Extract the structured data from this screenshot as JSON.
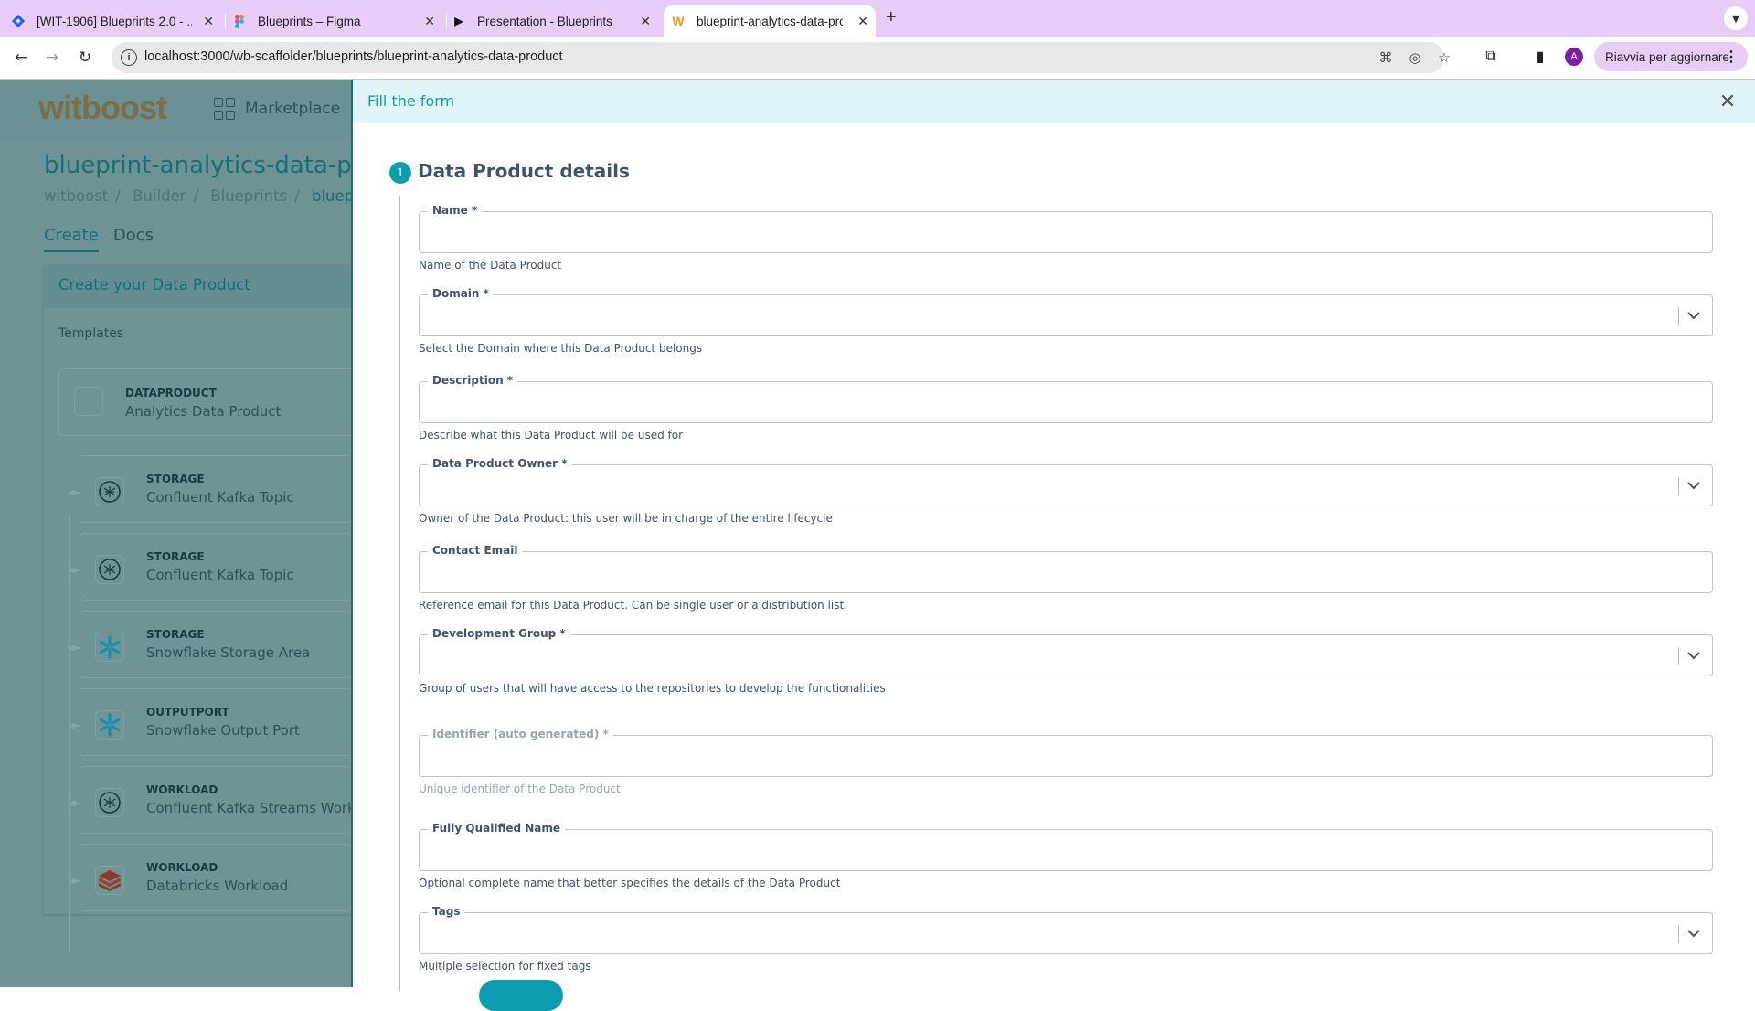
{
  "browser": {
    "tabs": [
      {
        "label": "[WIT-1906] Blueprints 2.0 - ...",
        "icon": "jira-icon",
        "active": false
      },
      {
        "label": "Blueprints – Figma",
        "icon": "figma-icon",
        "active": false
      },
      {
        "label": "Presentation - Blueprints",
        "icon": "play-icon",
        "active": false
      },
      {
        "label": "blueprint-analytics-data-pro",
        "icon": "witboost-icon",
        "active": true
      }
    ],
    "new_tab": "+",
    "url": "localhost:3000/wb-scaffolder/blueprints/blueprint-analytics-data-product",
    "profile_initial": "A",
    "update_button": "Riavvia per aggiornare",
    "colors": {
      "tabbar": "#e9cdf9",
      "profile": "#7b1fa2"
    }
  },
  "app": {
    "logo": "witboost",
    "nav": {
      "marketplace": "Marketplace"
    },
    "page_title": "blueprint-analytics-data-product",
    "breadcrumb": [
      "witboost",
      "Builder",
      "Blueprints",
      "blueprint-analytics-data-product"
    ],
    "tabs": [
      {
        "label": "Create",
        "active": true
      },
      {
        "label": "Docs",
        "active": false
      }
    ],
    "card": {
      "title": "Create your Data Product",
      "subtitle": "Templates",
      "templates": [
        {
          "kind": "DATAPRODUCT",
          "name": "Analytics Data Product",
          "icon": "blank-icon"
        },
        {
          "kind": "STORAGE",
          "name": "Confluent Kafka Topic",
          "icon": "confluent-icon"
        },
        {
          "kind": "STORAGE",
          "name": "Confluent Kafka Topic",
          "icon": "confluent-icon"
        },
        {
          "kind": "STORAGE",
          "name": "Snowflake Storage Area",
          "icon": "snowflake-icon"
        },
        {
          "kind": "OUTPUTPORT",
          "name": "Snowflake Output Port",
          "icon": "snowflake-icon"
        },
        {
          "kind": "WORKLOAD",
          "name": "Confluent Kafka Streams Workload",
          "icon": "confluent-icon"
        },
        {
          "kind": "WORKLOAD",
          "name": "Databricks Workload",
          "icon": "databricks-icon"
        }
      ]
    },
    "colors": {
      "accent": "#176f78",
      "overlay_bg": "#6f9294"
    }
  },
  "drawer": {
    "title": "Fill the form",
    "step": {
      "number": "1",
      "title": "Data Product details"
    },
    "fields": [
      {
        "label": "Name *",
        "type": "text",
        "value": "",
        "help": "Name of the Data Product",
        "disabled": false
      },
      {
        "label": "Domain *",
        "type": "select",
        "value": "",
        "help": "Select the Domain where this Data Product belongs",
        "disabled": false
      },
      {
        "label": "Description *",
        "type": "text",
        "value": "",
        "help": "Describe what this Data Product will be used for",
        "disabled": false
      },
      {
        "label": "Data Product Owner *",
        "type": "select",
        "value": "",
        "help": "Owner of the Data Product: this user will be in charge of the entire lifecycle",
        "disabled": false
      },
      {
        "label": "Contact Email",
        "type": "text",
        "value": "",
        "help": "Reference email for this Data Product. Can be single user or a distribution list.",
        "disabled": false
      },
      {
        "label": "Development Group *",
        "type": "select",
        "value": "",
        "help": "Group of users that will have access to the repositories to develop the functionalities",
        "disabled": false
      },
      {
        "label": "Identifier (auto generated) *",
        "type": "text",
        "value": "",
        "help": "Unique identifier of the Data Product",
        "disabled": true
      },
      {
        "label": "Fully Qualified Name",
        "type": "text",
        "value": "",
        "help": "Optional complete name that better specifies the details of the Data Product",
        "disabled": false
      },
      {
        "label": "Tags",
        "type": "select",
        "value": "",
        "help": "Multiple selection for fixed tags",
        "disabled": false
      }
    ],
    "colors": {
      "header_bg": "#e0f5f8",
      "primary": "#0d9db1",
      "label": "#3f5567"
    }
  }
}
